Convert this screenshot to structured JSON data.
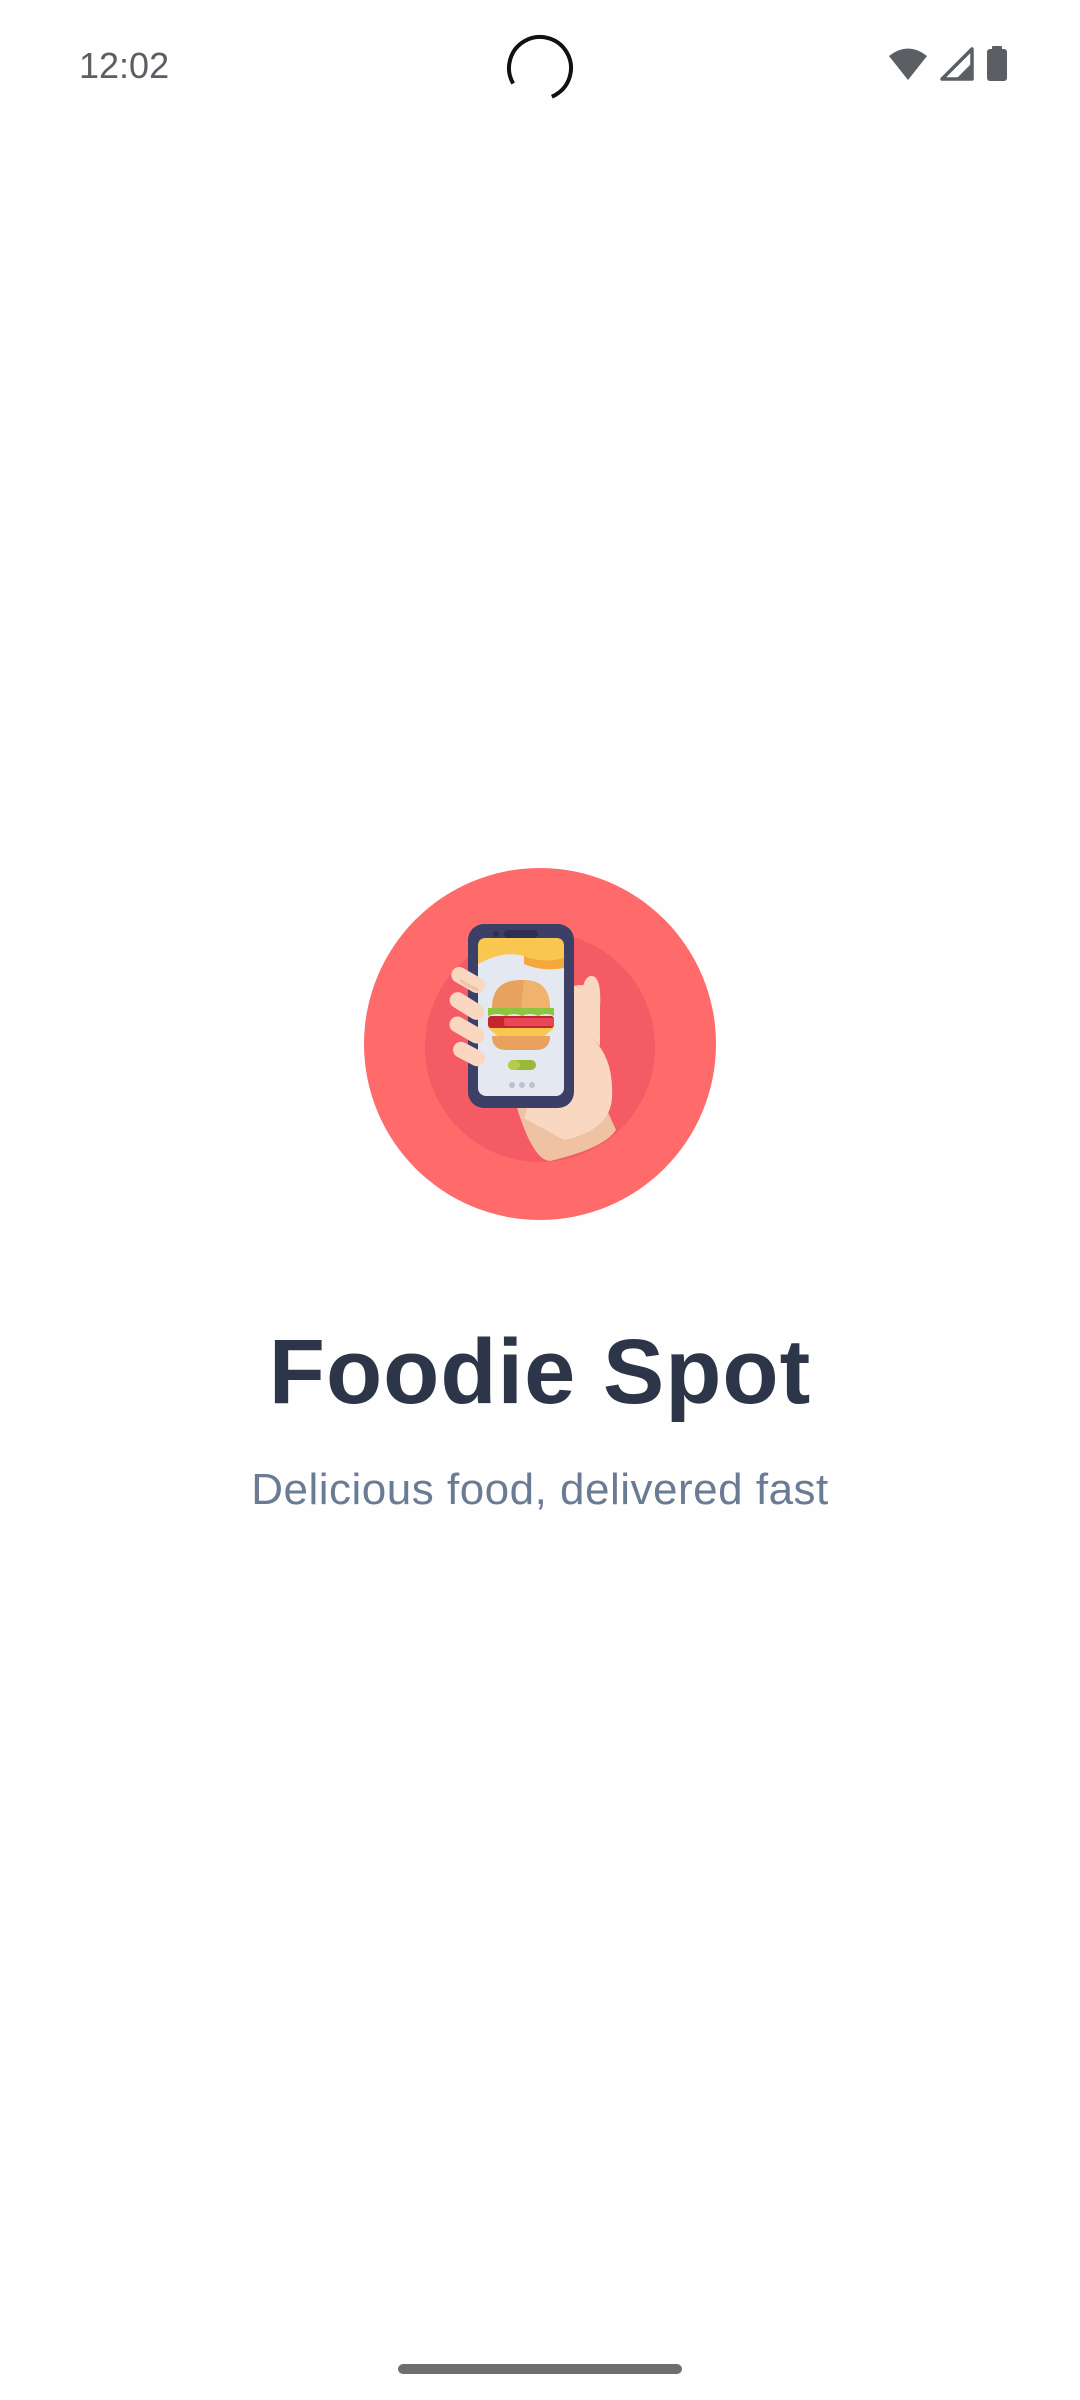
{
  "status_bar": {
    "time": "12:02",
    "icons": [
      "wifi-icon",
      "cellular-signal-icon",
      "battery-icon"
    ]
  },
  "splash": {
    "logo_icon": "phone-burger-hand-icon",
    "title": "Foodie Spot",
    "tagline": "Delicious food, delivered fast"
  },
  "colors": {
    "logo_background": "#ff6b6b",
    "logo_inner": "#f45b64",
    "title": "#2d3648",
    "tagline": "#6a7b94",
    "background": "#fefefe"
  }
}
